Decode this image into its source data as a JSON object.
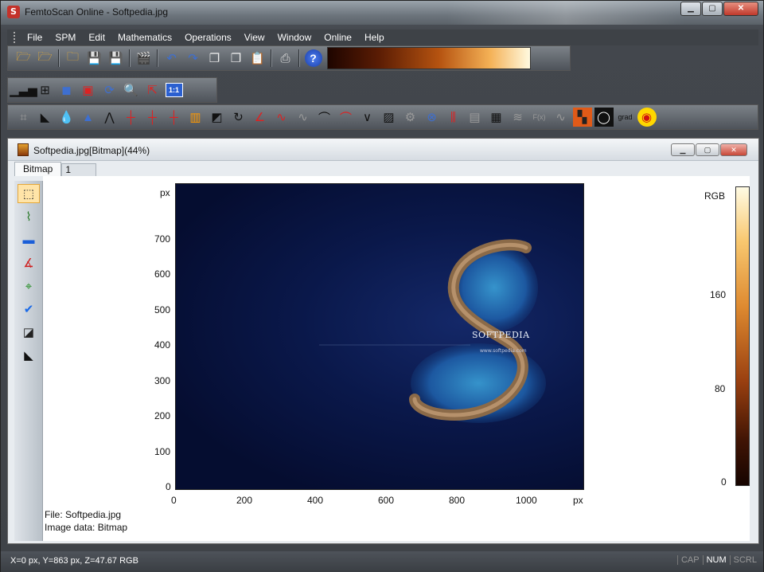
{
  "window": {
    "title": "FemtoScan Online - Softpedia.jpg",
    "app_icon": "S"
  },
  "menu": [
    "File",
    "SPM",
    "Edit",
    "Mathematics",
    "Operations",
    "View",
    "Window",
    "Online",
    "Help"
  ],
  "toolbar1": {
    "icons": [
      "open-folder-icon",
      "open-folder-icon",
      "open-scan-folder-icon",
      "save-icon",
      "save-all-icon",
      "movie-icon",
      "undo-icon",
      "redo-icon",
      "copy-icon",
      "copy-icon",
      "paste-icon",
      "print-icon",
      "help-icon"
    ],
    "palette": "copper"
  },
  "toolbar2": {
    "icons": [
      "histogram-icon",
      "grid-icon",
      "cube-icon",
      "frame-icon",
      "refresh-icon",
      "zoom-icon",
      "resize-icon"
    ],
    "scale_label": "1:1"
  },
  "toolbar3": {
    "grad_label": "grad",
    "fx_label": "F(x)"
  },
  "child": {
    "title": "Softpedia.jpg[Bitmap](44%)",
    "tab_active": "Bitmap",
    "tab_inactive": "1"
  },
  "plot": {
    "y_unit": "px",
    "x_unit": "px",
    "y_ticks": [
      "700",
      "600",
      "500",
      "400",
      "300",
      "200",
      "100",
      "0"
    ],
    "x_ticks": [
      "0",
      "200",
      "400",
      "600",
      "800",
      "1000"
    ],
    "brand": "SOFTPEDIA",
    "url": "www.softpedia.com"
  },
  "colorbar": {
    "label": "RGB",
    "ticks": [
      "160",
      "80",
      "0"
    ]
  },
  "info": {
    "file": "File: Softpedia.jpg",
    "image_data": "Image data: Bitmap"
  },
  "status": {
    "text": "X=0 px, Y=863 px, Z=47.67 RGB",
    "cap": "CAP",
    "num": "NUM",
    "scrl": "SCRL"
  }
}
